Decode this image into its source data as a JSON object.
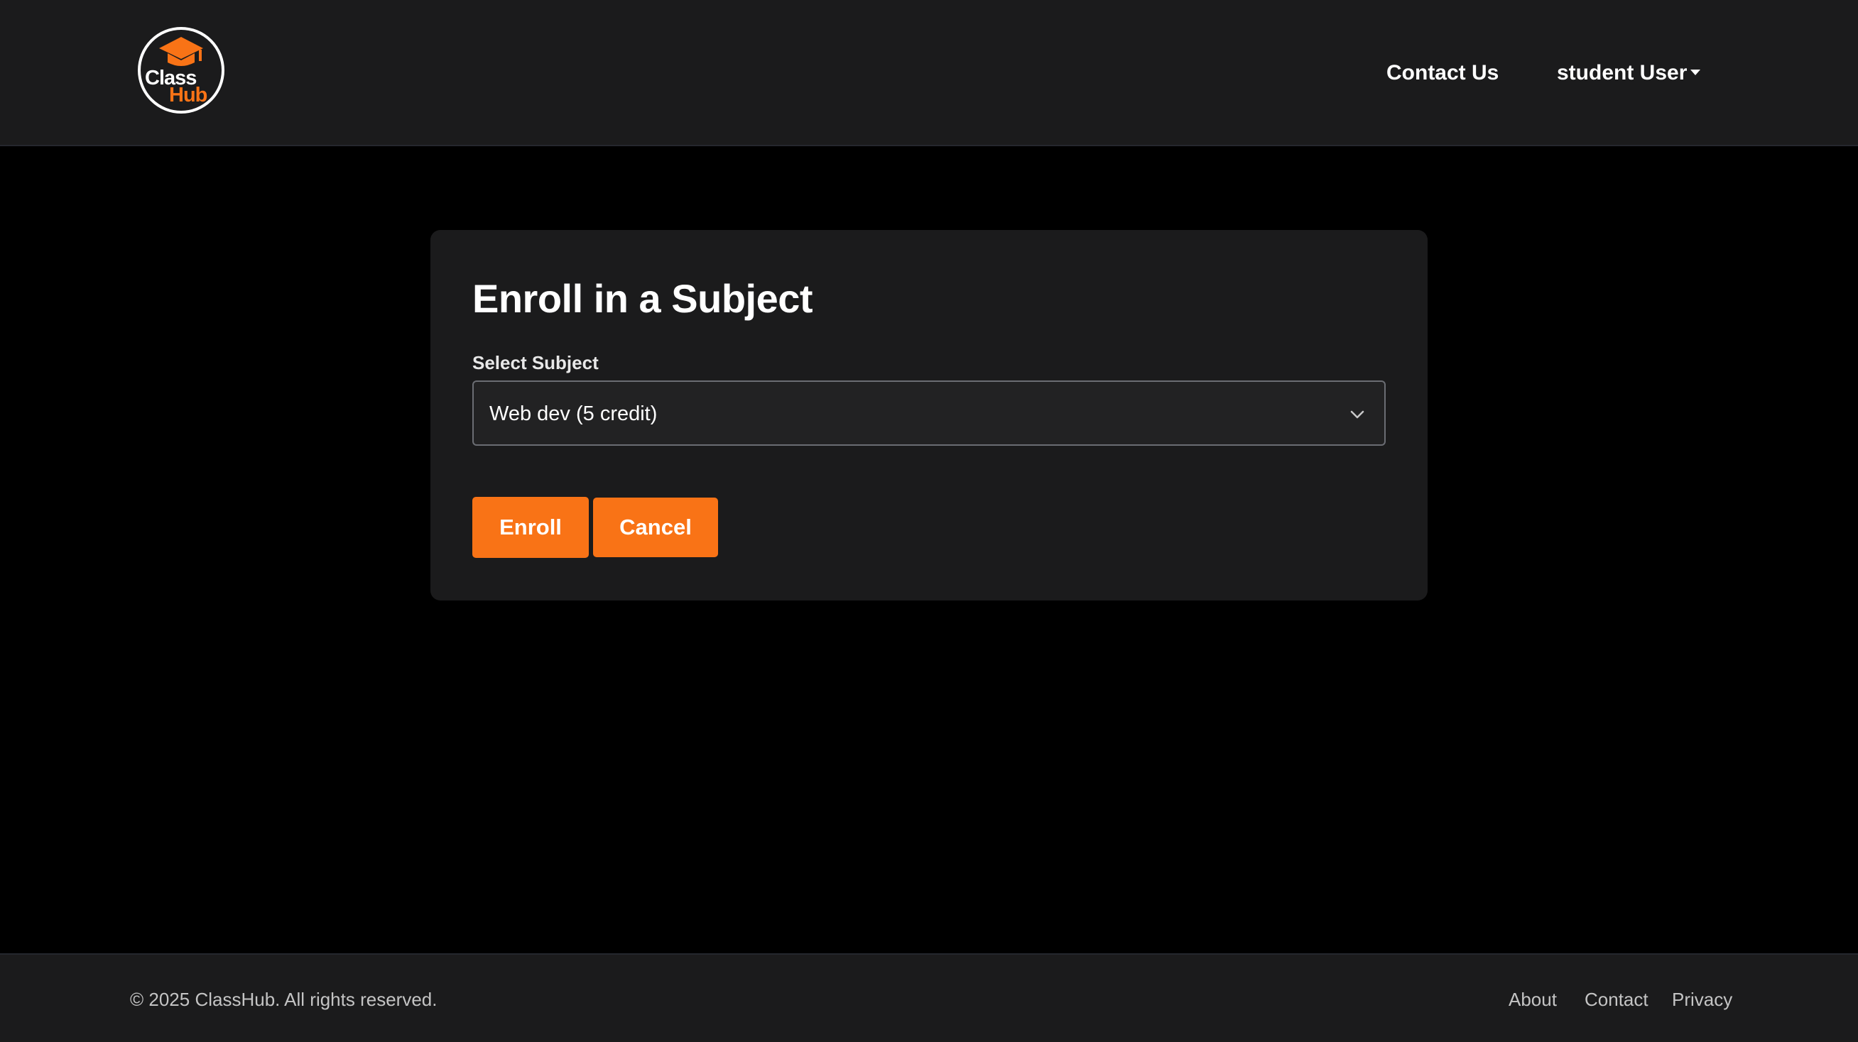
{
  "brand": {
    "logo_word_1": "Class",
    "logo_word_2": "Hub",
    "accent_color": "#f97316",
    "logo_icon": "graduation-cap-icon"
  },
  "navbar": {
    "contact_label": "Contact Us",
    "user_label": "student User",
    "user_caret_icon": "caret-down-icon"
  },
  "enroll_form": {
    "title": "Enroll in a Subject",
    "select_label": "Select Subject",
    "selected_subject": "Web dev (5 credit)",
    "select_icon": "chevron-down-icon",
    "enroll_button": "Enroll",
    "cancel_button": "Cancel"
  },
  "footer": {
    "copyright": "© 2025 ClassHub. All rights reserved.",
    "links": [
      "About",
      "Contact",
      "Privacy"
    ]
  }
}
